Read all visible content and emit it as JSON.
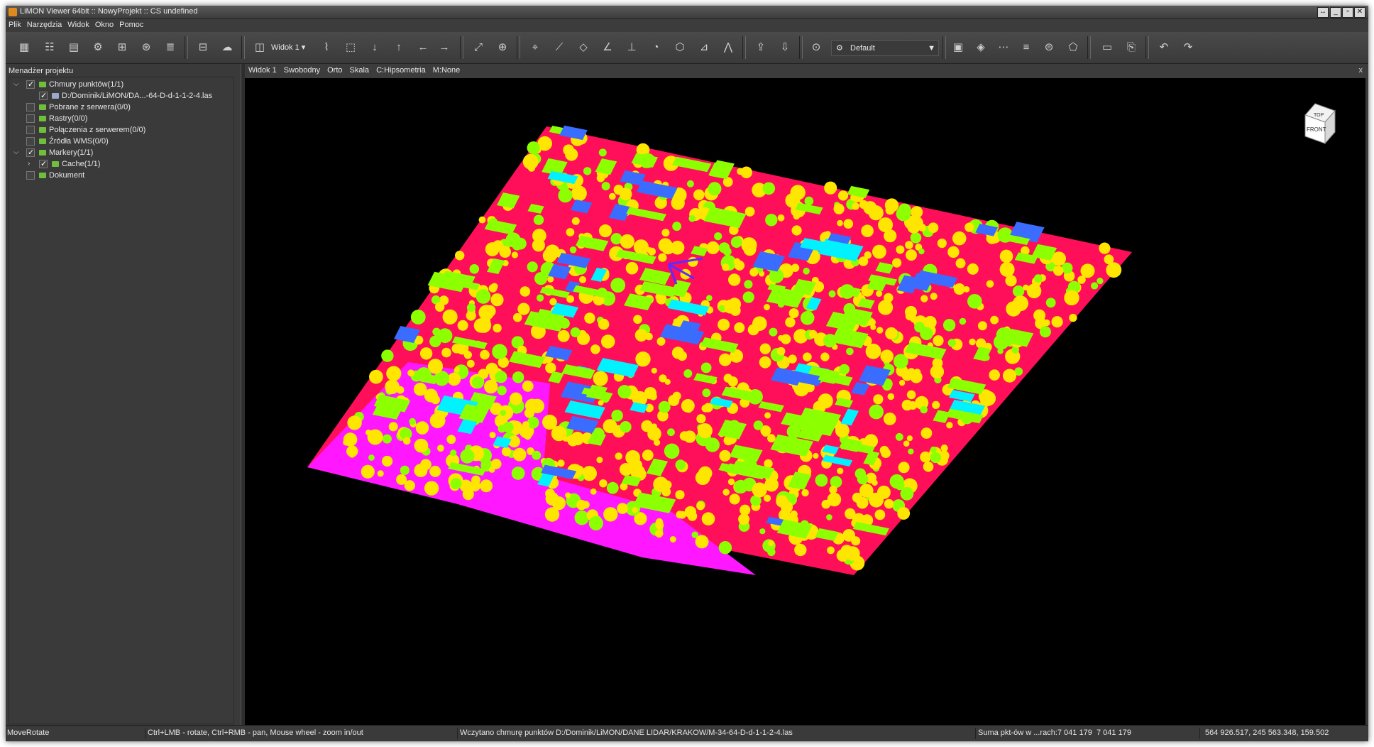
{
  "window": {
    "title": "LiMON Viewer 64bit :: NowyProjekt :: CS undefined"
  },
  "menu": [
    "Plik",
    "Narzędzia",
    "Widok",
    "Okno",
    "Pomoc"
  ],
  "toolbar": {
    "view_label": "Widok 1",
    "color_scheme": "Default"
  },
  "project": {
    "header": "Menadżer projektu",
    "items": [
      {
        "label": "Chmury punktów(1/1)",
        "checked": true
      },
      {
        "label": "D:/Dominik/LiMON/DA...-64-D-d-1-1-2-4.las",
        "checked": true
      },
      {
        "label": "Pobrane z serwera(0/0)",
        "checked": false
      },
      {
        "label": "Rastry(0/0)",
        "checked": false
      },
      {
        "label": "Połączenia z serwerem(0/0)",
        "checked": false
      },
      {
        "label": "Źródła WMS(0/0)",
        "checked": false
      },
      {
        "label": "Markery(1/1)",
        "checked": true
      },
      {
        "label": "Cache(1/1)",
        "checked": true
      },
      {
        "label": "Dokument",
        "checked": false
      }
    ]
  },
  "view_header": [
    "Widok 1",
    "Swobodny",
    "Orto",
    "Skala",
    "C:Hipsometria",
    "M:None"
  ],
  "viewcube": {
    "top": "TOP",
    "front": "FRONT"
  },
  "status": {
    "mode": "MoveRotate",
    "hint": "Ctrl+LMB - rotate, Ctrl+RMB - pan, Mouse wheel - zoom in/out",
    "message": "Wczytano chmurę punktów D:/Dominik/LiMON/DANE LIDAR/KRAKOW/M-34-64-D-d-1-1-2-4.las",
    "points": "Suma pkt-ów w ...rach:7 041 179",
    "points2": "7 041 179",
    "coords": "564 926.517, 245 563.348, 159.502"
  },
  "colors": {
    "ground": "#ff0f5a",
    "low": "#ffe600",
    "mid": "#8cff00",
    "high": "#00f2ff",
    "top": "#3a6cff",
    "lowest": "#ff18ff"
  }
}
